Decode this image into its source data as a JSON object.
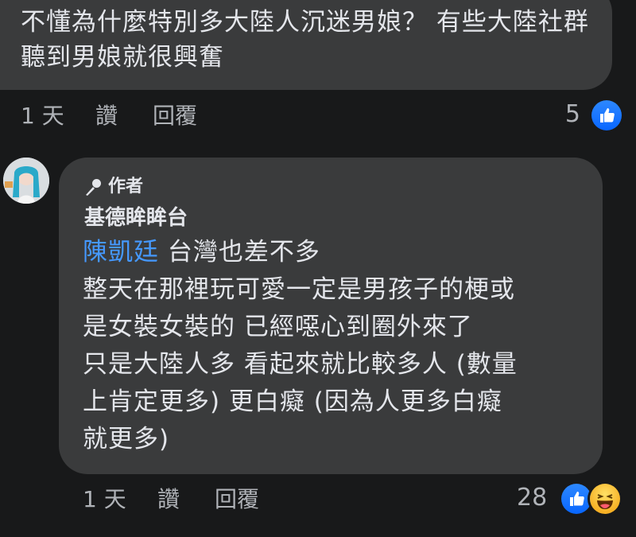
{
  "comment1": {
    "text": "不懂為什麼特別多大陸人沉迷男娘？ 有些大陸社群聽到男娘就很興奮",
    "time": "1 天",
    "like_label": "讚",
    "reply_label": "回覆",
    "reaction_count": "5",
    "reaction_icons": [
      "like-icon"
    ]
  },
  "comment2": {
    "author_badge": "作者",
    "author_name": "基德眸眸台",
    "mention": "陳凱廷",
    "text_after_mention": " 台灣也差不多",
    "lines": [
      "整天在那裡玩可愛一定是男孩子的梗或",
      "是女裝女裝的 已經噁心到圈外來了",
      "只是大陸人多 看起來就比較多人 (數量",
      "上肯定更多) 更白癡 (因為人更多白癡",
      "就更多)"
    ],
    "time": "1 天",
    "like_label": "讚",
    "reply_label": "回覆",
    "reaction_count": "28",
    "reaction_icons": [
      "like-icon",
      "haha-icon"
    ]
  },
  "colors": {
    "background": "#18191a",
    "bubble": "#3a3b3c",
    "text": "#e4e6eb",
    "secondary_text": "#b0b3b8",
    "mention": "#4599ff",
    "like_blue": "#0866ff"
  }
}
